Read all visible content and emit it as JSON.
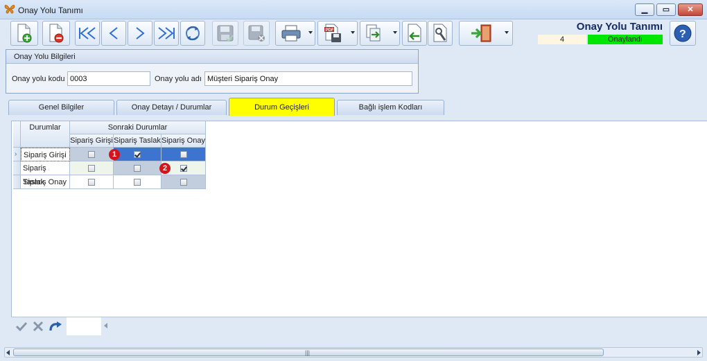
{
  "window": {
    "title": "Onay Yolu Tanımı"
  },
  "header": {
    "title": "Onay Yolu Tanımı",
    "record_no": "4",
    "status": "Onaylandı",
    "status_color": "#00e600"
  },
  "group": {
    "title": "Onay Yolu Bilgileri",
    "code_label": "Onay yolu kodu",
    "code_value": "0003",
    "name_label": "Onay yolu adı",
    "name_value": "Müşteri Sipariş Onay"
  },
  "tabs": [
    {
      "label": "Genel Bilgiler"
    },
    {
      "label": "Onay Detayı / Durumlar"
    },
    {
      "label": "Durum Geçişleri",
      "active": true
    },
    {
      "label": "Bağlı işlem Kodları"
    }
  ],
  "active_tab_color": "#ffff00",
  "grid": {
    "col_durumlar": "Durumlar",
    "col_sonraki": "Sonraki Durumlar",
    "subcols": [
      "Sipariş Girişi",
      "Sipariş Taslak",
      "Sipariş Onay"
    ],
    "rows": [
      {
        "name": "Sipariş Girişi",
        "checks": [
          false,
          true,
          false
        ]
      },
      {
        "name": "Sipariş Taslak",
        "checks": [
          false,
          false,
          true
        ]
      },
      {
        "name": "Sipariş Onay",
        "checks": [
          false,
          false,
          false
        ]
      }
    ],
    "markers": [
      "1",
      "2"
    ]
  },
  "icons": {
    "toolbar": [
      "new-document-icon",
      "delete-document-icon",
      "first-record-icon",
      "previous-record-icon",
      "next-record-icon",
      "last-record-icon",
      "refresh-icon",
      "save-icon",
      "cancel-save-icon",
      "print-icon",
      "pdf-export-icon",
      "export-icon",
      "import-icon",
      "settings-tool-icon",
      "exit-door-icon"
    ],
    "navigator": [
      "accept-check-icon",
      "cancel-x-icon",
      "redo-icon"
    ]
  }
}
